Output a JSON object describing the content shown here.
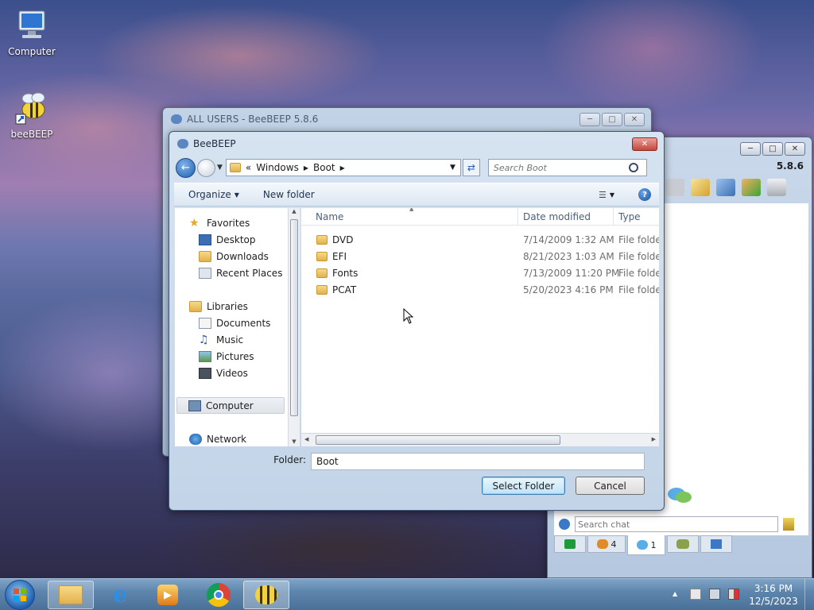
{
  "desktop": {
    "icons": [
      {
        "label": "Computer"
      },
      {
        "label": "beeBEEP"
      }
    ]
  },
  "bg_window": {
    "title": "ALL USERS - BeeBEEP 5.8.6"
  },
  "chat_window": {
    "version": "5.8.6",
    "search_placeholder": "Search chat",
    "tab_users_count": "4",
    "tab_chats_count": "1"
  },
  "dialog": {
    "title": "BeeBEEP",
    "breadcrumb": {
      "overflow": "«",
      "parts": [
        "Windows",
        "Boot"
      ]
    },
    "search_placeholder": "Search Boot",
    "toolbar": {
      "organize": "Organize",
      "new_folder": "New folder"
    },
    "nav": {
      "favorites": "Favorites",
      "favorites_items": [
        "Desktop",
        "Downloads",
        "Recent Places"
      ],
      "libraries": "Libraries",
      "libraries_items": [
        "Documents",
        "Music",
        "Pictures",
        "Videos"
      ],
      "computer": "Computer",
      "network": "Network"
    },
    "columns": {
      "name": "Name",
      "date": "Date modified",
      "type": "Type"
    },
    "files": [
      {
        "name": "DVD",
        "date": "7/14/2009 1:32 AM",
        "type": "File folder"
      },
      {
        "name": "EFI",
        "date": "8/21/2023 1:03 AM",
        "type": "File folder"
      },
      {
        "name": "Fonts",
        "date": "7/13/2009 11:20 PM",
        "type": "File folder"
      },
      {
        "name": "PCAT",
        "date": "5/20/2023 4:16 PM",
        "type": "File folder"
      }
    ],
    "folder_label": "Folder:",
    "folder_value": "Boot",
    "select_button": "Select Folder",
    "cancel_button": "Cancel"
  },
  "taskbar": {
    "time": "3:16 PM",
    "date": "12/5/2023"
  }
}
